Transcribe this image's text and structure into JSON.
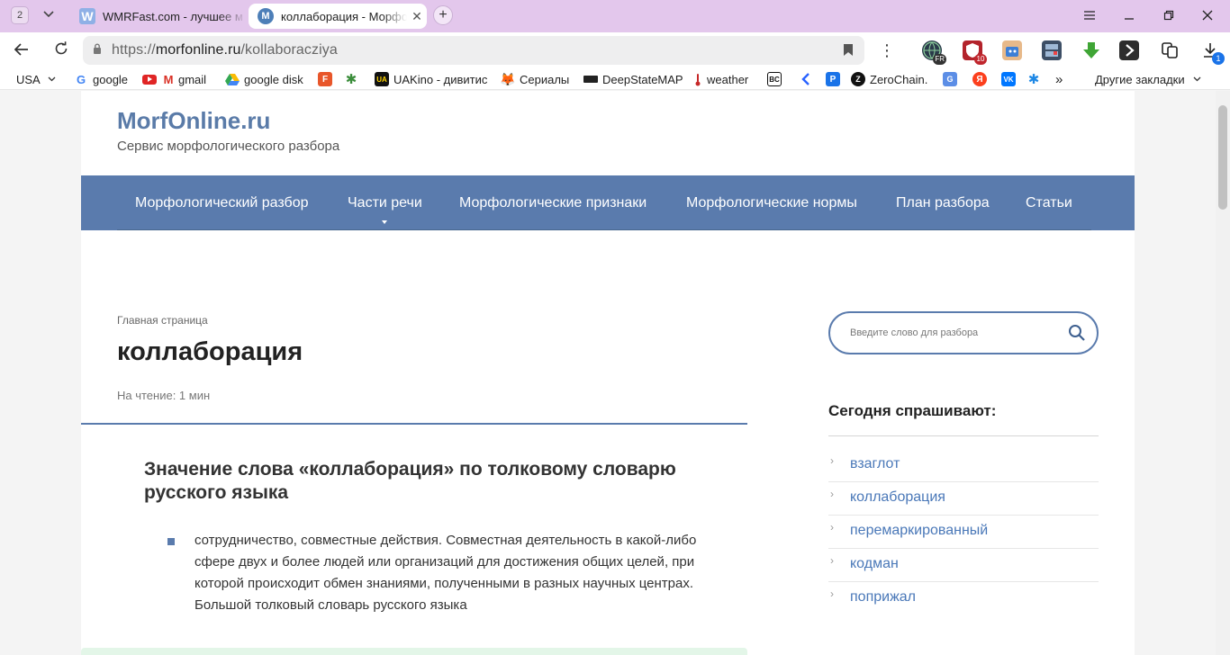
{
  "browser": {
    "tab_count": "2",
    "tabs": [
      {
        "title": "WMRFast.com - лучшее м",
        "favicon": "W",
        "active": false
      },
      {
        "title": "коллаборация - Морфо",
        "favicon": "M",
        "active": true
      }
    ],
    "address": {
      "scheme": "https://",
      "host": "morfonline.ru",
      "path": "/kollaboracziya"
    },
    "extension_badges": {
      "red": "10",
      "blue": "1",
      "globe": "FR"
    },
    "bookmarks": [
      {
        "label": "USA",
        "icon": "chevron-down-icon"
      },
      {
        "label": "google",
        "icon": "google-icon"
      },
      {
        "label": "gmail",
        "icon": "gmail-icon"
      },
      {
        "label": "google disk",
        "icon": "google-drive-icon"
      },
      {
        "label": "",
        "icon": "f-icon"
      },
      {
        "label": "",
        "icon": "star-logo-icon"
      },
      {
        "label": "UAKino - дивитис",
        "icon": "uakino-icon"
      },
      {
        "label": "Сериалы",
        "icon": "fox-icon"
      },
      {
        "label": "DeepStateMAP",
        "icon": "deepstate-icon"
      },
      {
        "label": "weather",
        "icon": "thermometer-icon"
      },
      {
        "label": "",
        "icon": "bc-icon"
      },
      {
        "label": "",
        "icon": "chevron-left-icon"
      },
      {
        "label": "",
        "icon": "p-icon"
      },
      {
        "label": "ZeroChain.",
        "icon": "zerochain-icon"
      },
      {
        "label": "",
        "icon": "translate-icon"
      },
      {
        "label": "",
        "icon": "yandex-icon"
      },
      {
        "label": "",
        "icon": "vk-icon"
      },
      {
        "label": "",
        "icon": "snowflake-icon"
      }
    ],
    "bookmarks_overflow": "»",
    "other_bookmarks": "Другие закладки"
  },
  "site": {
    "title": "MorfOnline.ru",
    "description": "Сервис морфологического разбора",
    "nav": [
      "Морфологический разбор",
      "Части речи",
      "Морфологические признаки",
      "Морфологические нормы",
      "План разбора",
      "Статьи"
    ]
  },
  "article": {
    "breadcrumb": "Главная страница",
    "title": "коллаборация",
    "read_time": "На чтение: 1 мин",
    "section_title": "Значение слова «коллаборация» по толковому словарю русского языка",
    "meaning_lines": [
      "сотрудничество, совместные действия. Совместная деятельность в какой-либо",
      "сфере двух и более людей или организаций для достижения общих целей, при",
      "которой происходит обмен знаниями, полученными в разных научных центрах.",
      "Большой толковый словарь русского языка"
    ]
  },
  "sidebar": {
    "search_placeholder": "Введите слово для разбора",
    "widget_title": "Сегодня спрашивают:",
    "popular": [
      "взаглот",
      "коллаборация",
      "перемаркированный",
      "кодман",
      "поприжал"
    ]
  },
  "colors": {
    "brand": "#5a7bad",
    "link": "#4a78b8",
    "tabstrip": "#e3c7ec"
  }
}
